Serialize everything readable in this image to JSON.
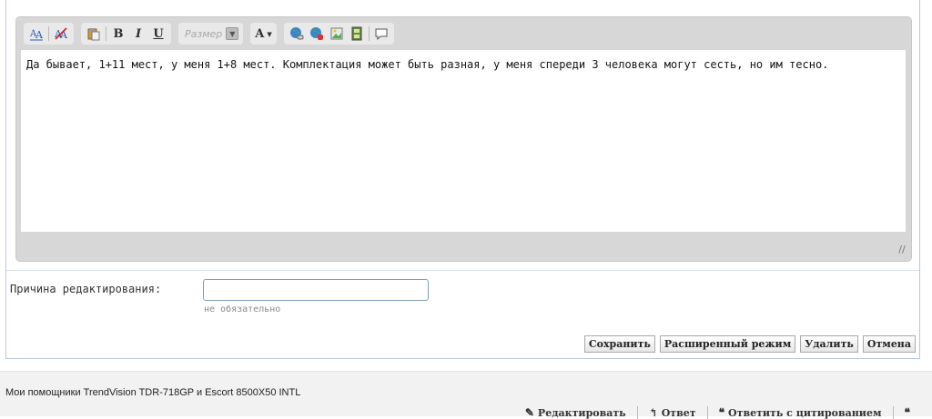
{
  "toolbar": {
    "size_placeholder": "Размер",
    "bold_label": "B",
    "italic_label": "I",
    "underline_label": "U",
    "color_label": "A",
    "icons": [
      "font-format-icon",
      "remove-format-icon",
      "paste-icon",
      "bold-icon",
      "italic-icon",
      "underline-icon",
      "size-dropdown",
      "text-color-icon",
      "insert-link-icon",
      "remove-link-icon",
      "insert-image-icon",
      "insert-media-icon",
      "quote-bubble-icon"
    ]
  },
  "editor": {
    "content": "Да бывает, 1+11 мест, у меня 1+8 мест. Комплектация может быть разная, у меня спереди 3 человека могут сесть, но им тесно."
  },
  "reason": {
    "label": "Причина редактирования:",
    "value": "",
    "hint": "не обязательно"
  },
  "buttons": {
    "save": "Сохранить",
    "advanced": "Расширенный режим",
    "delete": "Удалить",
    "cancel": "Отмена"
  },
  "post": {
    "signature": "Мои помощники TrendVision TDR-718GP и Escort 8500X50 INTL",
    "actions": {
      "edit": "Редактировать",
      "reply": "Ответ",
      "quote": "Ответить с цитированием"
    }
  },
  "colors": {
    "panel_border": "#b8c7d8",
    "toolbar_bg": "#d7d7d7",
    "input_border": "#7f9db9"
  }
}
